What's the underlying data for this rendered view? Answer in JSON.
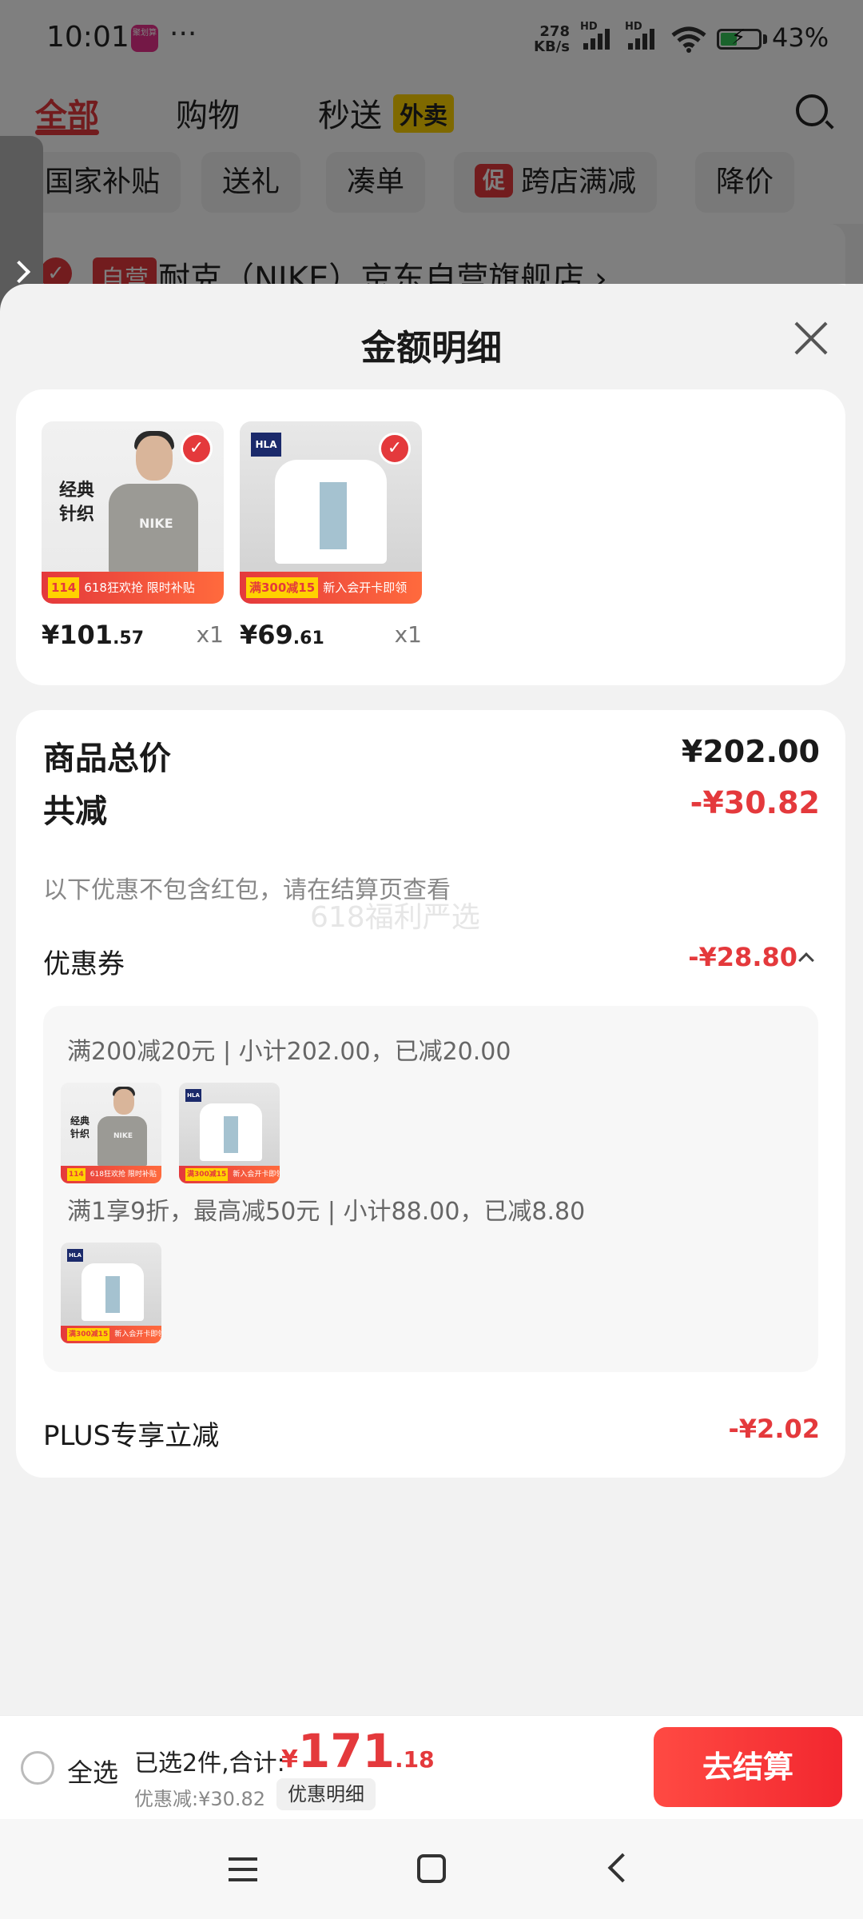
{
  "status_bar": {
    "time": "10:01",
    "app_badge": "聚划算",
    "more": "···",
    "net_speed_value": "278",
    "net_speed_unit": "KB/s",
    "hd": "HD",
    "battery_level": 0.43,
    "battery_text": "43%"
  },
  "background_page": {
    "tabs": [
      "全部",
      "购物",
      "秒送"
    ],
    "waimai_tag": "外卖",
    "chips": [
      "国家补贴",
      "送礼",
      "凑单",
      "跨店满减",
      "降价"
    ],
    "chip_promo_tag": "促",
    "store_tag": "自营",
    "store_name": "耐克（NIKE）京东自营旗舰店 ›"
  },
  "sheet": {
    "title": "金额明细",
    "products": [
      {
        "price_int": "¥101",
        "price_dec": ".57",
        "qty": "x1",
        "image_text": "经典\n针织",
        "logo": "NIKE",
        "promo_price": "114",
        "promo_text": "618狂欢抢 限时补贴"
      },
      {
        "price_int": "¥69",
        "price_dec": ".61",
        "qty": "x1",
        "logo": "HLA",
        "promo_price": "满300减15",
        "promo_text": "新入会开卡即领"
      }
    ],
    "summary": {
      "total_label": "商品总价",
      "total_value": "¥202.00",
      "reduction_label": "共减",
      "reduction_value": "-¥30.82",
      "note": "以下优惠不包含红包，请在结算页查看",
      "watermark": "618福利严选",
      "coupon_label": "优惠券",
      "coupon_value": "-¥28.80",
      "coupon_rules": [
        {
          "text": "满200减20元 | 小计202.00，已减20.00"
        },
        {
          "text": "满1享9折，最高减50元 | 小计88.00，已减8.80"
        }
      ],
      "plus_label": "PLUS专享立减",
      "plus_value": "-¥2.02"
    }
  },
  "bottom_bar": {
    "select_all": "全选",
    "selected_text": "已选2件,合计:",
    "currency": "¥",
    "total_int": "171",
    "total_dec": ".18",
    "discount_text": "优惠减:¥30.82",
    "detail_button": "优惠明细",
    "checkout_button": "去结算"
  },
  "colors": {
    "accent_red": "#e4393c",
    "checkout_gradient_start": "#ff4a43",
    "battery_green": "#34c759"
  },
  "icons": [
    "search-icon",
    "close-icon",
    "check-icon",
    "chevron-up-icon",
    "menu-icon",
    "home-icon",
    "back-icon",
    "wifi-icon",
    "signal-icon",
    "battery-icon"
  ]
}
